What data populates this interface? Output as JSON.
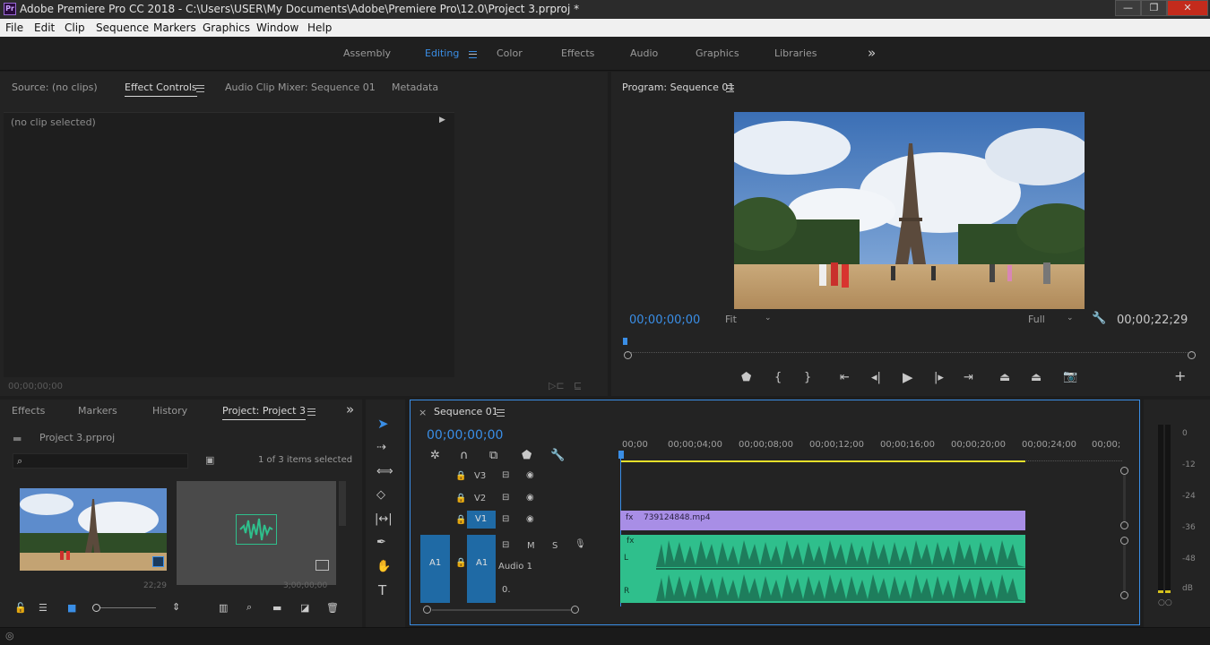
{
  "titlebar": {
    "logo": "Pr",
    "title": "Adobe Premiere Pro CC 2018 - C:\\Users\\USER\\My Documents\\Adobe\\Premiere Pro\\12.0\\Project 3.prproj *",
    "min": "—",
    "max": "❐",
    "close": "✕"
  },
  "menu": [
    "File",
    "Edit",
    "Clip",
    "Sequence",
    "Markers",
    "Graphics",
    "Window",
    "Help"
  ],
  "workspaces": [
    "Assembly",
    "Editing",
    "Color",
    "Effects",
    "Audio",
    "Graphics",
    "Libraries"
  ],
  "workspace_more": "»",
  "source_panel": {
    "tabs": [
      "Source: (no clips)",
      "Effect Controls",
      "Audio Clip Mixer: Sequence 01",
      "Metadata"
    ],
    "no_clip": "(no clip selected)",
    "timecode": "00;00;00;00"
  },
  "program_panel": {
    "title": "Program: Sequence 01",
    "timecode": "00;00;00;00",
    "fit": "Fit",
    "quality": "Full",
    "duration": "00;00;22;29"
  },
  "project_panel": {
    "tabs": [
      "Effects",
      "Markers",
      "History",
      "Project: Project 3"
    ],
    "more": "»",
    "project_file": "Project 3.prproj",
    "selection": "1 of 3 items selected",
    "thumb_labels": [
      "22;29",
      "3;00;00;00"
    ]
  },
  "timeline": {
    "close": "×",
    "title": "Sequence 01",
    "timecode": "00;00;00;00",
    "ruler": [
      "00;00",
      "00;00;04;00",
      "00;00;08;00",
      "00;00;12;00",
      "00;00;16;00",
      "00;00;20;00",
      "00;00;24;00",
      "00;00;"
    ],
    "tracks": {
      "v3": "V3",
      "v2": "V2",
      "v1": "V1",
      "a1_src": "A1",
      "a1": "A1",
      "a1_name": "Audio 1",
      "mute": "M",
      "solo": "S",
      "vol": "0."
    },
    "video_clip": "739124848.mp4",
    "audio_fx": "fx",
    "channel_l": "L",
    "channel_r": "R"
  },
  "meter": {
    "labels": [
      "0",
      "-12",
      "-24",
      "-36",
      "-48",
      "dB"
    ],
    "solo": "○○"
  },
  "colors": {
    "accent_blue": "#3a8ee6",
    "video_clip": "#a88ee6",
    "audio_clip": "#2fbf8c",
    "work_area": "#e6e02a"
  }
}
